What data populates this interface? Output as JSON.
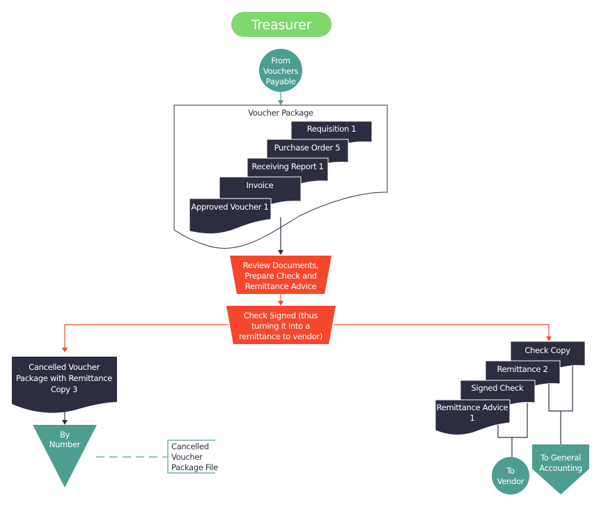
{
  "diagram": {
    "title": "Treasurer",
    "colors": {
      "title_green": "#7ed86c",
      "teal": "#4e9e90",
      "navy": "#2c2d3f",
      "orange_red": "#f4472b",
      "line_dark": "#2c2d3f"
    },
    "start_connector": {
      "lines": [
        "From",
        "Vouchers",
        "Payable"
      ]
    },
    "voucher_package": {
      "label": "Voucher Package",
      "documents": [
        {
          "label": "Requisition 1"
        },
        {
          "label": "Purchase Order 5"
        },
        {
          "label": "Receiving Report 1"
        },
        {
          "label": "Invoice"
        },
        {
          "label": "Approved Voucher 1"
        }
      ]
    },
    "process_review": {
      "lines": [
        "Review Documents,",
        "Prepare Check and",
        "Remittance Advice"
      ]
    },
    "process_signed": {
      "lines": [
        "Check Signed (thus",
        "turning it into a",
        "remittance to vendor)"
      ]
    },
    "left_branch": {
      "document": {
        "lines": [
          "Cancelled Voucher",
          "Package with Remittance",
          "Copy 3"
        ]
      },
      "file_storage": {
        "lines": [
          "By",
          "Number"
        ]
      },
      "annotation": {
        "lines": [
          "Cancelled",
          "Voucher",
          "Package File"
        ]
      }
    },
    "right_branch": {
      "documents": [
        {
          "lines": [
            "Check Copy"
          ]
        },
        {
          "lines": [
            "Remittance 2"
          ]
        },
        {
          "lines": [
            "Signed Check"
          ]
        },
        {
          "lines": [
            "Remittance Advice",
            "1"
          ]
        }
      ],
      "to_vendor": {
        "lines": [
          "To",
          "Vendor"
        ]
      },
      "to_general_accounting": {
        "lines": [
          "To General",
          "Accounting"
        ]
      }
    }
  }
}
